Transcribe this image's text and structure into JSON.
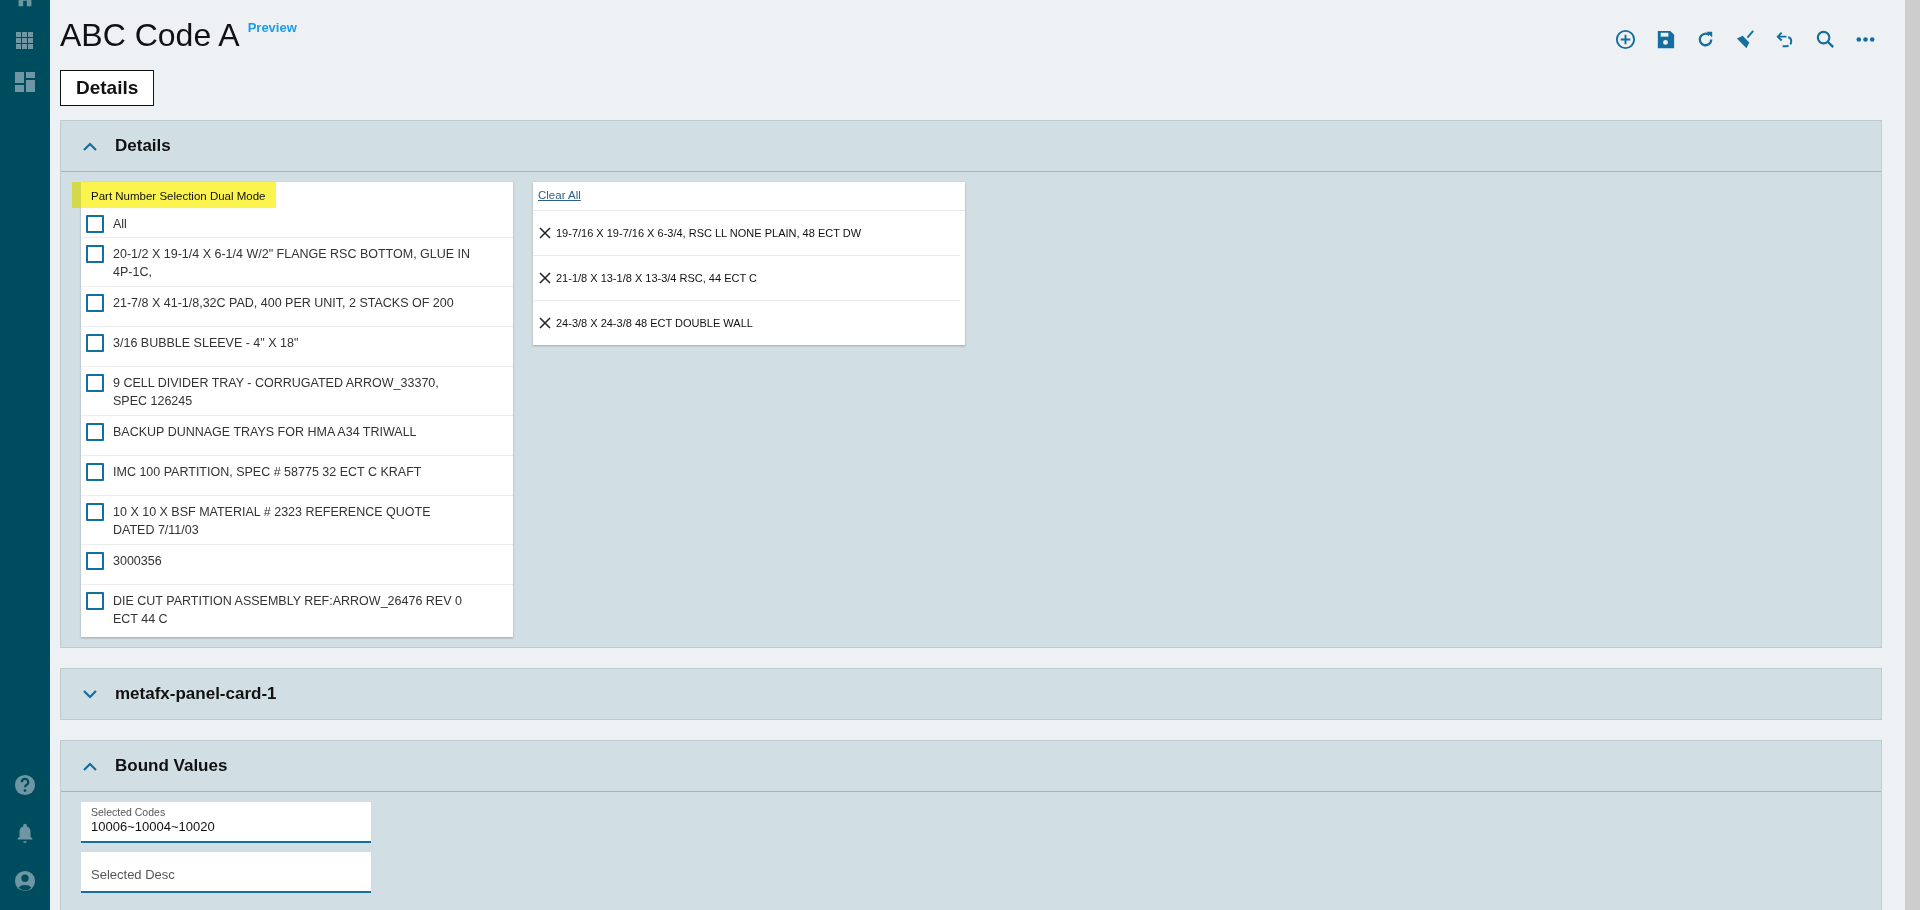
{
  "page": {
    "title": "ABC Code A",
    "badge": "Preview"
  },
  "tabs": [
    {
      "label": "Details",
      "selected": true
    }
  ],
  "details_panel": {
    "title": "Details",
    "expanded": true,
    "part_selector": {
      "label": "Part Number Selection Dual Mode",
      "highlighted": true,
      "options": [
        {
          "label": "All",
          "checked": false
        },
        {
          "label": "20-1/2 X 19-1/4 X 6-1/4 W/2\" FLANGE RSC BOTTOM, GLUE IN 4P-1C,",
          "checked": false
        },
        {
          "label": "21-7/8 X 41-1/8,32C PAD, 400 PER UNIT, 2 STACKS OF 200",
          "checked": false
        },
        {
          "label": "3/16 BUBBLE SLEEVE - 4\" X 18\"",
          "checked": false
        },
        {
          "label": "9 CELL DIVIDER TRAY - CORRUGATED ARROW_33370, SPEC 126245",
          "checked": false
        },
        {
          "label": "BACKUP DUNNAGE TRAYS FOR HMA A34 TRIWALL",
          "checked": false
        },
        {
          "label": "IMC 100 PARTITION, SPEC # 58775 32 ECT C KRAFT",
          "checked": false
        },
        {
          "label": "10 X 10 X BSF MATERIAL # 2323 REFERENCE QUOTE DATED 7/11/03",
          "checked": false
        },
        {
          "label": "3000356",
          "checked": false
        },
        {
          "label": "DIE CUT PARTITION ASSEMBLY REF:ARROW_26476 REV 0 ECT 44 C",
          "checked": false
        }
      ]
    },
    "selected_list": {
      "clear_all": "Clear All",
      "items": [
        "19-7/16 X 19-7/16 X 6-3/4, RSC LL NONE PLAIN, 48 ECT DW",
        "21-1/8 X 13-1/8 X 13-3/4 RSC, 44 ECT C",
        "24-3/8 X 24-3/8 48 ECT DOUBLE WALL"
      ]
    }
  },
  "metafx_panel": {
    "title": "metafx-panel-card-1",
    "expanded": false
  },
  "bound_values_panel": {
    "title": "Bound Values",
    "expanded": true,
    "fields": [
      {
        "label": "Selected Codes",
        "value": "10006~10004~10020"
      },
      {
        "label": "Selected Desc"
      }
    ]
  }
}
